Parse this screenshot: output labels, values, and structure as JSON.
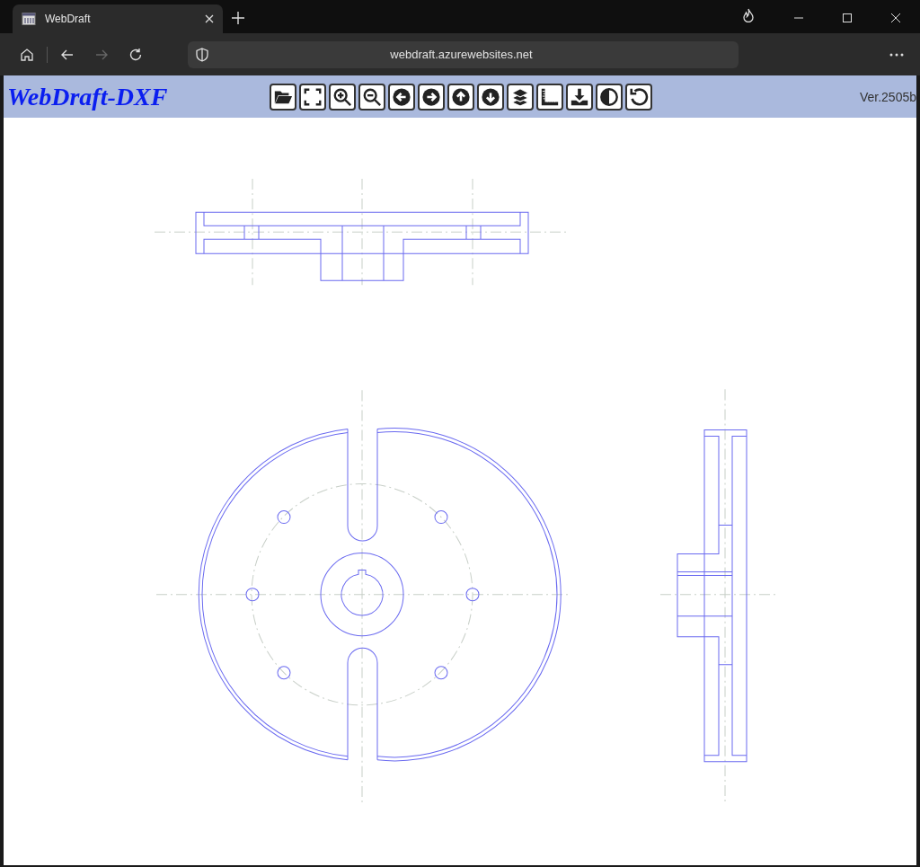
{
  "browser": {
    "tab": {
      "title": "WebDraft"
    },
    "address": {
      "url": "webdraft.azurewebsites.net"
    },
    "forward": {
      "disabled": true
    }
  },
  "app": {
    "title": "WebDraft-DXF",
    "version": "Ver.2505b",
    "toolbar": [
      {
        "kind": "open"
      },
      {
        "kind": "fit"
      },
      {
        "kind": "zoom-in"
      },
      {
        "kind": "zoom-out"
      },
      {
        "kind": "left"
      },
      {
        "kind": "right"
      },
      {
        "kind": "up"
      },
      {
        "kind": "down"
      },
      {
        "kind": "layers"
      },
      {
        "kind": "measure"
      },
      {
        "kind": "download"
      },
      {
        "kind": "contrast"
      },
      {
        "kind": "undo"
      }
    ]
  }
}
